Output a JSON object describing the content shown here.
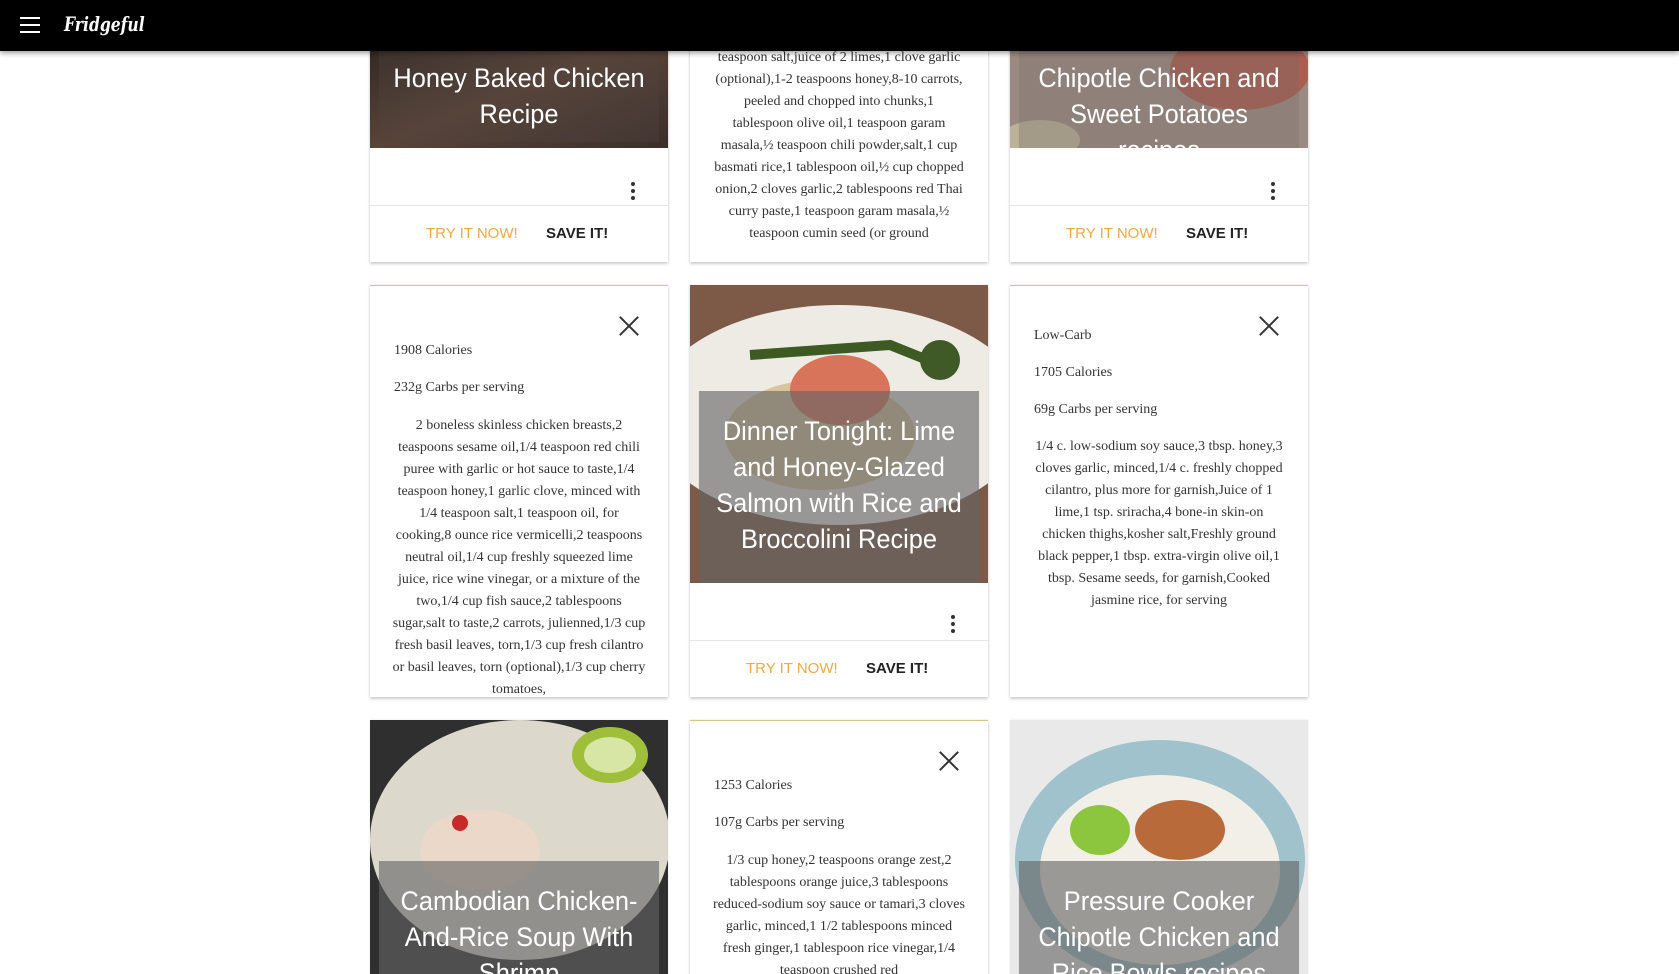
{
  "app": {
    "brand": "Fridgeful"
  },
  "cards": {
    "c1": {
      "title": "Honey Baked Chicken Recipe",
      "try_label": "TRY IT NOW!",
      "save_label": "SAVE IT!"
    },
    "c2": {
      "ingredients": "teaspoon salt,juice of 2 limes,1 clove garlic (optional),1-2 teaspoons honey,8-10 carrots, peeled and chopped into chunks,1 tablespoon olive oil,1 teaspoon garam masala,½ teaspoon chili powder,salt,1 cup basmati rice,1 tablespoon oil,½ cup chopped onion,2 cloves garlic,2 tablespoons red Thai curry paste,1 teaspoon garam masala,½ teaspoon cumin seed (or ground"
    },
    "c3": {
      "title": "Chipotle Chicken and Sweet Potatoes recipes",
      "try_label": "TRY IT NOW!",
      "save_label": "SAVE IT!"
    },
    "c4": {
      "calories": "1908 Calories",
      "carbs": "232g Carbs per serving",
      "ingredients": "2 boneless skinless chicken breasts,2 teaspoons sesame oil,1/4 teaspoon red chili puree with garlic or hot sauce to taste,1/4 teaspoon honey,1 garlic clove, minced with 1/4 teaspoon salt,1 teaspoon oil, for cooking,8 ounce rice vermicelli,2 teaspoons neutral oil,1/4 cup freshly squeezed lime juice, rice wine vinegar, or a mixture of the two,1/4 cup fish sauce,2 tablespoons sugar,salt to taste,2 carrots, julienned,1/3 cup fresh basil leaves, torn,1/3 cup fresh cilantro or basil leaves, torn (optional),1/3 cup cherry tomatoes,"
    },
    "c5": {
      "title": "Dinner Tonight: Lime and Honey-Glazed Salmon with Rice and Broccolini Recipe",
      "try_label": "TRY IT NOW!",
      "save_label": "SAVE IT!"
    },
    "c6": {
      "diet": "Low-Carb",
      "calories": "1705 Calories",
      "carbs": "69g Carbs per serving",
      "ingredients": "1/4 c. low-sodium soy sauce,3 tbsp. honey,3 cloves garlic, minced,1/4 c. freshly chopped cilantro, plus more for garnish,Juice of 1 lime,1 tsp. sriracha,4 bone-in skin-on chicken thighs,kosher salt,Freshly ground black pepper,1 tbsp. extra-virgin olive oil,1 tbsp. Sesame seeds, for garnish,Cooked jasmine rice, for serving"
    },
    "c7": {
      "title": "Cambodian Chicken-And-Rice Soup With Shrimp"
    },
    "c8": {
      "calories": "1253 Calories",
      "carbs": "107g Carbs per serving",
      "ingredients": "1/3 cup honey,2 teaspoons orange zest,2 tablespoons orange juice,3 tablespoons reduced-sodium soy sauce or tamari,3 cloves garlic, minced,1 1/2 tablespoons minced fresh ginger,1 tablespoon rice vinegar,1/4 teaspoon crushed red"
    },
    "c9": {
      "title": "Pressure Cooker Chipotle Chicken and Rice Bowls recipes"
    }
  },
  "colors": {
    "accent": "#f5a742",
    "topbar": "#000000",
    "overlay": "rgba(100,100,100,0.62)"
  },
  "icons": {
    "menu": "hamburger-menu-icon",
    "more": "more-vert-icon",
    "close": "close-icon"
  }
}
